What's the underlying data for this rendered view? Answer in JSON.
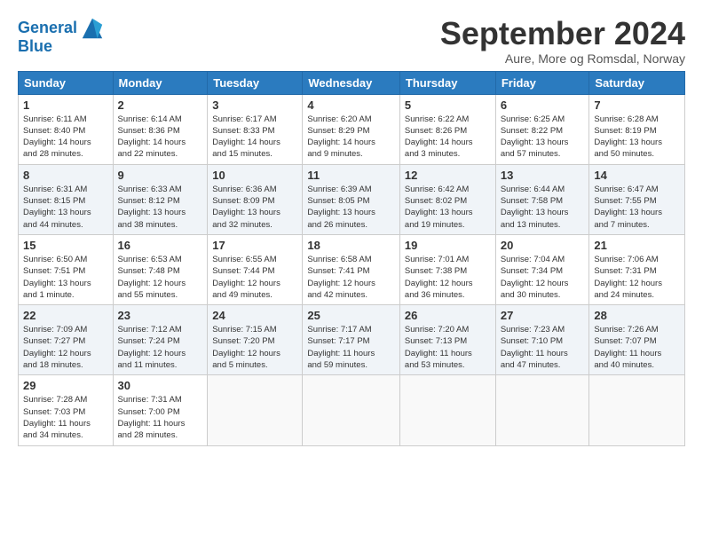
{
  "logo": {
    "line1": "General",
    "line2": "Blue"
  },
  "title": "September 2024",
  "subtitle": "Aure, More og Romsdal, Norway",
  "headers": [
    "Sunday",
    "Monday",
    "Tuesday",
    "Wednesday",
    "Thursday",
    "Friday",
    "Saturday"
  ],
  "weeks": [
    [
      {
        "day": "1",
        "info": "Sunrise: 6:11 AM\nSunset: 8:40 PM\nDaylight: 14 hours\nand 28 minutes."
      },
      {
        "day": "2",
        "info": "Sunrise: 6:14 AM\nSunset: 8:36 PM\nDaylight: 14 hours\nand 22 minutes."
      },
      {
        "day": "3",
        "info": "Sunrise: 6:17 AM\nSunset: 8:33 PM\nDaylight: 14 hours\nand 15 minutes."
      },
      {
        "day": "4",
        "info": "Sunrise: 6:20 AM\nSunset: 8:29 PM\nDaylight: 14 hours\nand 9 minutes."
      },
      {
        "day": "5",
        "info": "Sunrise: 6:22 AM\nSunset: 8:26 PM\nDaylight: 14 hours\nand 3 minutes."
      },
      {
        "day": "6",
        "info": "Sunrise: 6:25 AM\nSunset: 8:22 PM\nDaylight: 13 hours\nand 57 minutes."
      },
      {
        "day": "7",
        "info": "Sunrise: 6:28 AM\nSunset: 8:19 PM\nDaylight: 13 hours\nand 50 minutes."
      }
    ],
    [
      {
        "day": "8",
        "info": "Sunrise: 6:31 AM\nSunset: 8:15 PM\nDaylight: 13 hours\nand 44 minutes."
      },
      {
        "day": "9",
        "info": "Sunrise: 6:33 AM\nSunset: 8:12 PM\nDaylight: 13 hours\nand 38 minutes."
      },
      {
        "day": "10",
        "info": "Sunrise: 6:36 AM\nSunset: 8:09 PM\nDaylight: 13 hours\nand 32 minutes."
      },
      {
        "day": "11",
        "info": "Sunrise: 6:39 AM\nSunset: 8:05 PM\nDaylight: 13 hours\nand 26 minutes."
      },
      {
        "day": "12",
        "info": "Sunrise: 6:42 AM\nSunset: 8:02 PM\nDaylight: 13 hours\nand 19 minutes."
      },
      {
        "day": "13",
        "info": "Sunrise: 6:44 AM\nSunset: 7:58 PM\nDaylight: 13 hours\nand 13 minutes."
      },
      {
        "day": "14",
        "info": "Sunrise: 6:47 AM\nSunset: 7:55 PM\nDaylight: 13 hours\nand 7 minutes."
      }
    ],
    [
      {
        "day": "15",
        "info": "Sunrise: 6:50 AM\nSunset: 7:51 PM\nDaylight: 13 hours\nand 1 minute."
      },
      {
        "day": "16",
        "info": "Sunrise: 6:53 AM\nSunset: 7:48 PM\nDaylight: 12 hours\nand 55 minutes."
      },
      {
        "day": "17",
        "info": "Sunrise: 6:55 AM\nSunset: 7:44 PM\nDaylight: 12 hours\nand 49 minutes."
      },
      {
        "day": "18",
        "info": "Sunrise: 6:58 AM\nSunset: 7:41 PM\nDaylight: 12 hours\nand 42 minutes."
      },
      {
        "day": "19",
        "info": "Sunrise: 7:01 AM\nSunset: 7:38 PM\nDaylight: 12 hours\nand 36 minutes."
      },
      {
        "day": "20",
        "info": "Sunrise: 7:04 AM\nSunset: 7:34 PM\nDaylight: 12 hours\nand 30 minutes."
      },
      {
        "day": "21",
        "info": "Sunrise: 7:06 AM\nSunset: 7:31 PM\nDaylight: 12 hours\nand 24 minutes."
      }
    ],
    [
      {
        "day": "22",
        "info": "Sunrise: 7:09 AM\nSunset: 7:27 PM\nDaylight: 12 hours\nand 18 minutes."
      },
      {
        "day": "23",
        "info": "Sunrise: 7:12 AM\nSunset: 7:24 PM\nDaylight: 12 hours\nand 11 minutes."
      },
      {
        "day": "24",
        "info": "Sunrise: 7:15 AM\nSunset: 7:20 PM\nDaylight: 12 hours\nand 5 minutes."
      },
      {
        "day": "25",
        "info": "Sunrise: 7:17 AM\nSunset: 7:17 PM\nDaylight: 11 hours\nand 59 minutes."
      },
      {
        "day": "26",
        "info": "Sunrise: 7:20 AM\nSunset: 7:13 PM\nDaylight: 11 hours\nand 53 minutes."
      },
      {
        "day": "27",
        "info": "Sunrise: 7:23 AM\nSunset: 7:10 PM\nDaylight: 11 hours\nand 47 minutes."
      },
      {
        "day": "28",
        "info": "Sunrise: 7:26 AM\nSunset: 7:07 PM\nDaylight: 11 hours\nand 40 minutes."
      }
    ],
    [
      {
        "day": "29",
        "info": "Sunrise: 7:28 AM\nSunset: 7:03 PM\nDaylight: 11 hours\nand 34 minutes."
      },
      {
        "day": "30",
        "info": "Sunrise: 7:31 AM\nSunset: 7:00 PM\nDaylight: 11 hours\nand 28 minutes."
      },
      {
        "day": "",
        "info": ""
      },
      {
        "day": "",
        "info": ""
      },
      {
        "day": "",
        "info": ""
      },
      {
        "day": "",
        "info": ""
      },
      {
        "day": "",
        "info": ""
      }
    ]
  ]
}
